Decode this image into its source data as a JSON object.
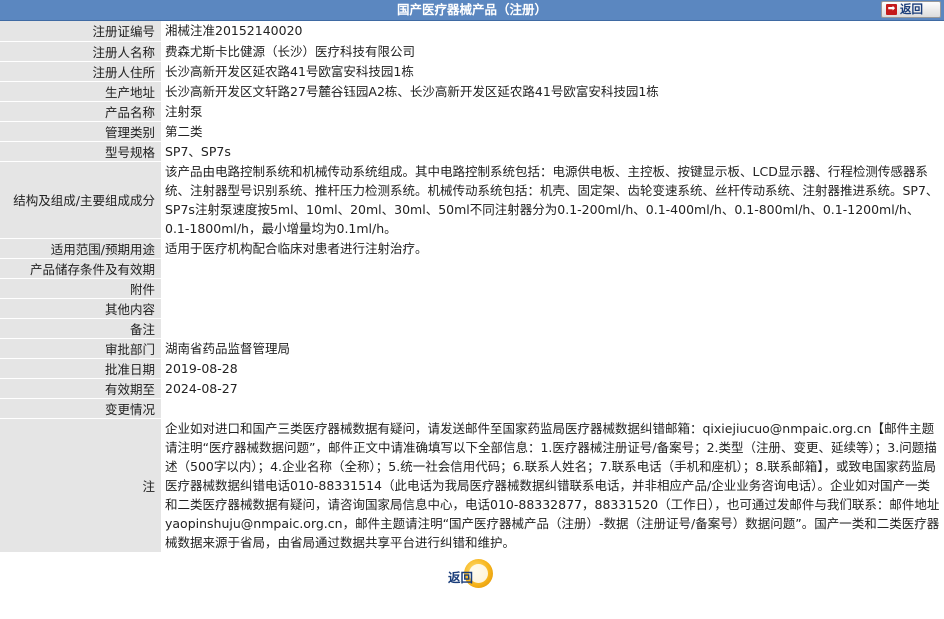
{
  "header": {
    "title": "国产医疗器械产品（注册）",
    "back_label": "返回"
  },
  "rows": [
    {
      "key": "注册证编号",
      "value": "湘械注准20152140020"
    },
    {
      "key": "注册人名称",
      "value": "费森尤斯卡比健源（长沙）医疗科技有限公司"
    },
    {
      "key": "注册人住所",
      "value": "长沙高新开发区延农路41号欧富安科技园1栋"
    },
    {
      "key": "生产地址",
      "value": "长沙高新开发区文轩路27号麓谷钰园A2栋、长沙高新开发区延农路41号欧富安科技园1栋"
    },
    {
      "key": "产品名称",
      "value": "注射泵"
    },
    {
      "key": "管理类别",
      "value": "第二类"
    },
    {
      "key": "型号规格",
      "value": "SP7、SP7s"
    },
    {
      "key": "结构及组成/主要组成成分",
      "value": "该产品由电路控制系统和机械传动系统组成。其中电路控制系统包括：电源供电板、主控板、按键显示板、LCD显示器、行程检测传感器系统、注射器型号识别系统、推杆压力检测系统。机械传动系统包括：机壳、固定架、齿轮变速系统、丝杆传动系统、注射器推进系统。SP7、SP7s注射泵速度按5ml、10ml、20ml、30ml、50ml不同注射器分为0.1-200ml/h、0.1-400ml/h、0.1-800ml/h、0.1-1200ml/h、0.1-1800ml/h，最小增量均为0.1ml/h。"
    },
    {
      "key": "适用范围/预期用途",
      "value": "适用于医疗机构配合临床对患者进行注射治疗。"
    },
    {
      "key": "产品储存条件及有效期",
      "value": ""
    },
    {
      "key": "附件",
      "value": ""
    },
    {
      "key": "其他内容",
      "value": ""
    },
    {
      "key": "备注",
      "value": ""
    },
    {
      "key": "审批部门",
      "value": "湖南省药品监督管理局"
    },
    {
      "key": "批准日期",
      "value": "2019-08-28"
    },
    {
      "key": "有效期至",
      "value": "2024-08-27"
    },
    {
      "key": "变更情况",
      "value": ""
    }
  ],
  "note": {
    "key": "注",
    "value": "企业如对进口和国产三类医疗器械数据有疑问，请发送邮件至国家药监局医疗器械数据纠错邮箱：qixiejiucuo@nmpaic.org.cn【邮件主题请注明“医疗器械数据问题”，邮件正文中请准确填写以下全部信息：1.医疗器械注册证号/备案号；2.类型（注册、变更、延续等）；3.问题描述（500字以内）；4.企业名称（全称）；5.统一社会信用代码；6.联系人姓名；7.联系电话（手机和座机）；8.联系邮箱】，或致电国家药监局医疗器械数据纠错电话010-88331514（此电话为我局医疗器械数据纠错联系电话，并非相应产品/企业业务咨询电话）。企业如对国产一类和二类医疗器械数据有疑问，请咨询国家局信息中心，电话010-88332877，88331520（工作日），也可通过发邮件与我们联系：邮件地址yaopinshuju@nmpaic.org.cn，邮件主题请注明“国产医疗器械产品（注册）-数据（注册证号/备案号）数据问题”。国产一类和二类医疗器械数据来源于省局，由省局通过数据共享平台进行纠错和维护。"
  },
  "footer": {
    "back_label": "返回"
  }
}
